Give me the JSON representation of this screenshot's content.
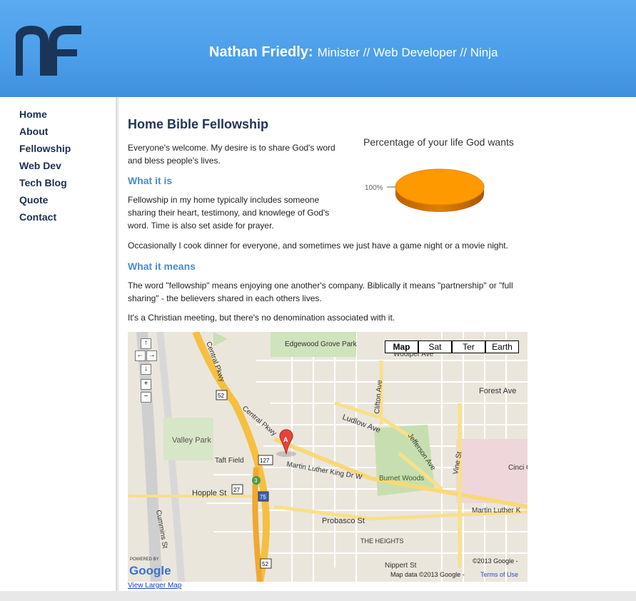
{
  "header": {
    "logo_text": "nf",
    "name": "Nathan Friedly:",
    "roles": "Minister // Web Developer // Ninja"
  },
  "nav": [
    "Home",
    "About",
    "Fellowship",
    "Web Dev",
    "Tech Blog",
    "Quote",
    "Contact"
  ],
  "content": {
    "title": "Home Bible Fellowship",
    "intro": "Everyone's welcome. My desire is to share God's word and bless people's lives.",
    "section1_heading": "What it is",
    "section1_p1": "Fellowship in my home typically includes someone sharing their heart, testimony, and knowlege of God's word. Time is also set aside for prayer.",
    "section1_p2": "Occasionally I cook dinner for everyone, and sometimes we just have a game night or a movie night.",
    "section2_heading": "What it means",
    "section2_p1": "The word \"fellowship\" means enjoying one another's company. Biblically it means \"partnership\" or \"full sharing\" - the believers shared in each others lives.",
    "section2_p2": "It's a Christian meeting, but there's no denomination associated with it."
  },
  "chart_data": {
    "type": "pie",
    "title": "Percentage of your life God wants",
    "slices": [
      {
        "label": "100%",
        "value": 100,
        "color": "#ff9900"
      }
    ]
  },
  "map": {
    "types": [
      "Map",
      "Sat",
      "Ter",
      "Earth"
    ],
    "selected_type": "Map",
    "nav_icons": [
      "arrow-up-icon",
      "arrow-left-icon",
      "arrow-right-icon",
      "arrow-down-icon",
      "zoom-in-icon",
      "zoom-out-icon"
    ],
    "labels": {
      "edgewood": "Edgewood Grove Park",
      "woolper": "Woolper Ave",
      "forest": "Forest Ave",
      "clifton": "Clifton Ave",
      "central": "Central Pkwy",
      "central2": "Central Pkwy",
      "ludlow": "Ludlow Ave",
      "valley": "Valley Park",
      "taft": "Taft Field",
      "mlk": "Martin Luther King Dr W",
      "mlk2": "Martin Luther K",
      "jefferson": "Jefferson Ave",
      "burnet": "Burnet Woods",
      "vine": "Vine St",
      "hopple": "Hopple St",
      "probasco": "Probasco St",
      "heights": "THE HEIGHTS",
      "cummins": "Cummins St",
      "cinci": "Cinci Children's Medica",
      "nippert": "Nippert St",
      "marker": "A",
      "r52": "52",
      "r52b": "52",
      "r127": "127",
      "r27": "27",
      "r75": "75",
      "r3": "3"
    },
    "powered_by": "POWERED BY",
    "google": "Google",
    "copyright": "©2013 Google -",
    "map_data": "Map data ©2013 Google -",
    "terms": "Terms of Use",
    "larger_map": "View Larger Map"
  }
}
